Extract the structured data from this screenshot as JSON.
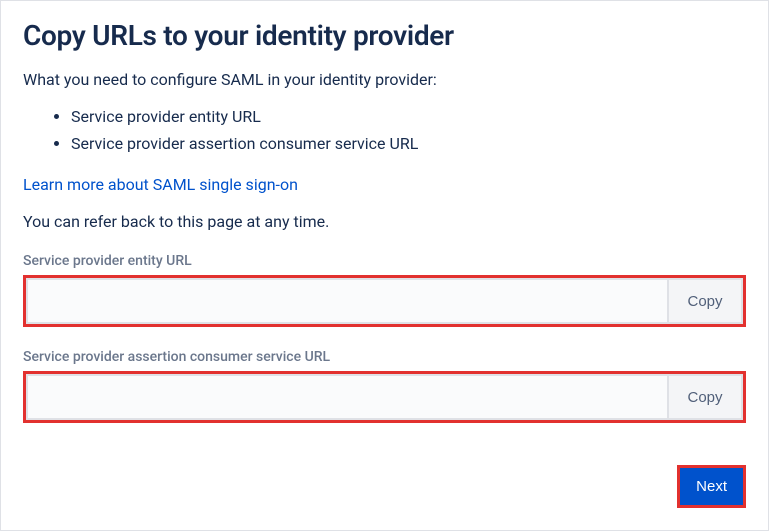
{
  "heading": "Copy URLs to your identity provider",
  "intro": "What you need to configure SAML in your identity provider:",
  "bullets": [
    "Service provider entity URL",
    "Service provider assertion consumer service URL"
  ],
  "learn_more": "Learn more about SAML single sign-on",
  "note": "You can refer back to this page at any time.",
  "fields": {
    "entity": {
      "label": "Service provider entity URL",
      "value": "",
      "copy_label": "Copy"
    },
    "acs": {
      "label": "Service provider assertion consumer service URL",
      "value": "",
      "copy_label": "Copy"
    }
  },
  "next_label": "Next"
}
